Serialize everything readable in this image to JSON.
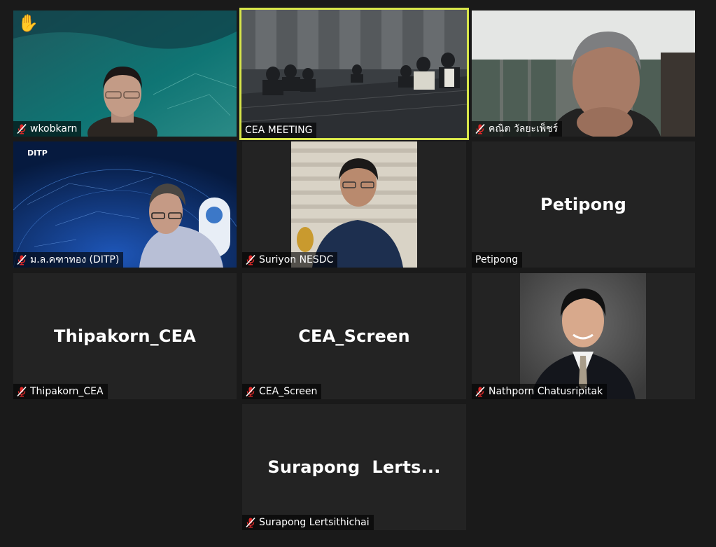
{
  "app": "video-meeting-gallery",
  "colors": {
    "background": "#1a1a1a",
    "tile": "#232323",
    "active_border": "#d8e64a",
    "mute_red": "#e02828"
  },
  "participants": [
    {
      "name": "wkobkarn",
      "muted": true,
      "raised_hand": true
    },
    {
      "name": "CEA MEETING",
      "muted": false,
      "active_speaker": true
    },
    {
      "name": "คณิต วัลยะเพ็ชร์",
      "muted": true
    },
    {
      "name": "ม.ล.คฑาทอง (DITP)",
      "muted": true,
      "background_logo": "DITP"
    },
    {
      "name": "Suriyon NESDC",
      "muted": true
    },
    {
      "name": "Petipong",
      "display_name": "Petipong",
      "muted": false
    },
    {
      "name": "Thipakorn_CEA",
      "display_name": "Thipakorn_CEA",
      "muted": true
    },
    {
      "name": "CEA_Screen",
      "display_name": "CEA_Screen",
      "muted": true
    },
    {
      "name": "Nathporn Chatusripitak",
      "muted": true
    },
    {
      "name": "Surapong Lertsithichai",
      "display_name": "Surapong  Lerts...",
      "muted": true
    }
  ]
}
